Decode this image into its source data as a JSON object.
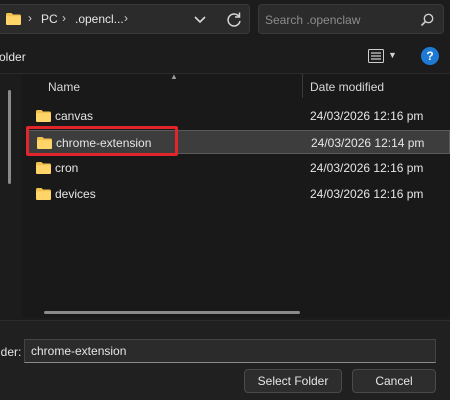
{
  "address": {
    "segments": [
      "PC",
      ".opencl..."
    ],
    "icons": {
      "folder": "folder-icon",
      "dropdown": "chevron-down-icon",
      "refresh": "refresh-icon"
    }
  },
  "search": {
    "placeholder": "Search .openclaw",
    "icon": "search-icon"
  },
  "toolbar": {
    "new_folder_label": "older",
    "view_icon": "view-list-icon",
    "help_label": "?"
  },
  "columns": {
    "name": "Name",
    "date": "Date modified"
  },
  "files": [
    {
      "name": "canvas",
      "date": "24/03/2026 12:16 pm"
    },
    {
      "name": "chrome-extension",
      "date": "24/03/2026 12:14 pm",
      "selected": true
    },
    {
      "name": "cron",
      "date": "24/03/2026 12:16 pm"
    },
    {
      "name": "devices",
      "date": "24/03/2026 12:16 pm"
    }
  ],
  "footer": {
    "folder_label": "lder:",
    "folder_value": "chrome-extension",
    "select_label": "Select Folder",
    "cancel_label": "Cancel"
  },
  "colors": {
    "folder": "#f2c14e",
    "highlight": "#e0262b",
    "help": "#1f7ad6"
  }
}
